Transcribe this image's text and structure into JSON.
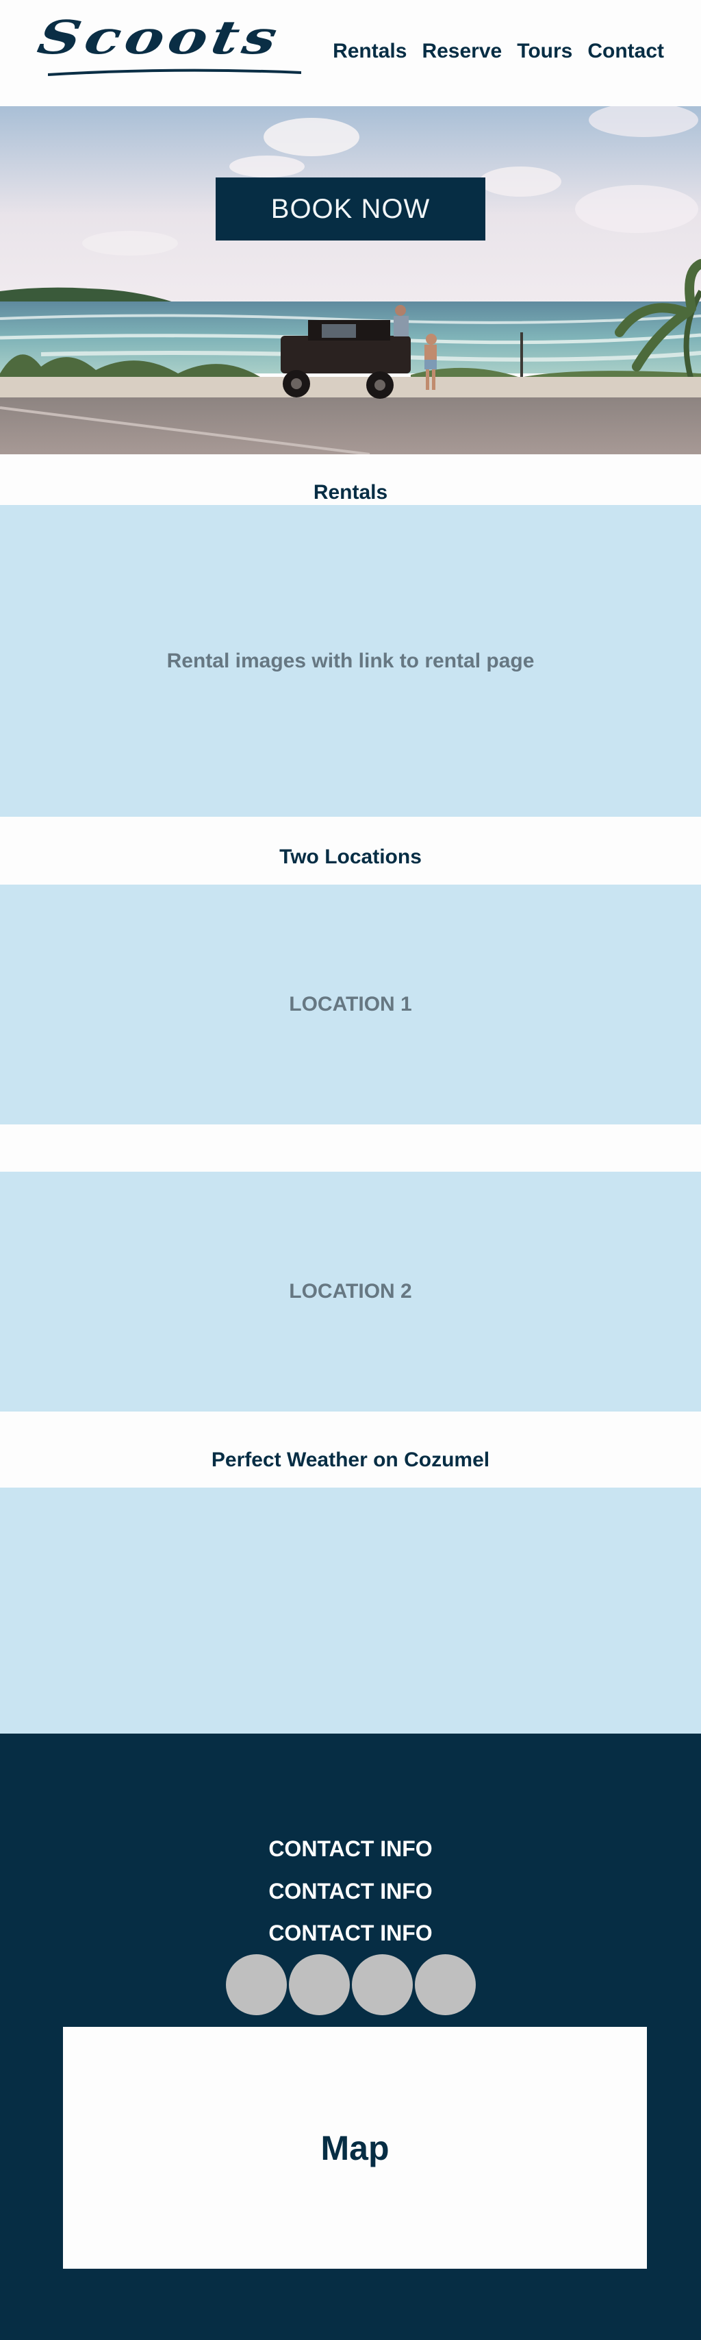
{
  "header": {
    "logo_text": "Scoots",
    "nav": [
      {
        "label": "Rentals"
      },
      {
        "label": "Reserve"
      },
      {
        "label": "Tours"
      },
      {
        "label": "Contact"
      }
    ]
  },
  "hero": {
    "book_label": "BOOK NOW"
  },
  "rentals": {
    "title": "Rentals",
    "placeholder": "Rental images with link to rental page"
  },
  "locations": {
    "title": "Two Locations",
    "items": [
      "LOCATION 1",
      "LOCATION 2"
    ]
  },
  "weather": {
    "title": "Perfect Weather on Cozumel"
  },
  "footer": {
    "contact_lines": [
      "CONTACT INFO",
      "CONTACT INFO",
      "CONTACT INFO"
    ],
    "map_label": "Map"
  },
  "colors": {
    "navy": "#062d44",
    "light_blue": "#c9e4f2",
    "social_gray": "#bfbfbf"
  }
}
